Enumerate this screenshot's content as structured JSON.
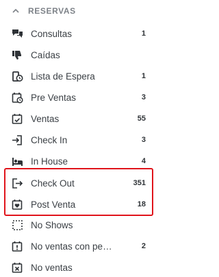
{
  "section": {
    "title": "RESERVAS"
  },
  "items": [
    {
      "label": "Consultas",
      "count": "1",
      "icon": "comments-icon"
    },
    {
      "label": "Caídas",
      "count": "",
      "icon": "thumbs-down-icon"
    },
    {
      "label": "Lista de Espera",
      "count": "1",
      "icon": "waitlist-clock-icon"
    },
    {
      "label": "Pre Ventas",
      "count": "3",
      "icon": "calendar-clock-icon"
    },
    {
      "label": "Ventas",
      "count": "55",
      "icon": "calendar-check-icon"
    },
    {
      "label": "Check In",
      "count": "3",
      "icon": "sign-in-icon"
    },
    {
      "label": "In House",
      "count": "4",
      "icon": "bed-icon"
    },
    {
      "label": "Check Out",
      "count": "351",
      "icon": "sign-out-icon"
    },
    {
      "label": "Post Venta",
      "count": "18",
      "icon": "calendar-heart-icon"
    },
    {
      "label": "No Shows",
      "count": "",
      "icon": "dashed-square-icon"
    },
    {
      "label": "No ventas con penalidad",
      "count": "2",
      "icon": "calendar-exclamation-icon"
    },
    {
      "label": "No ventas",
      "count": "",
      "icon": "calendar-x-icon"
    }
  ],
  "highlight_color": "#e0141b"
}
